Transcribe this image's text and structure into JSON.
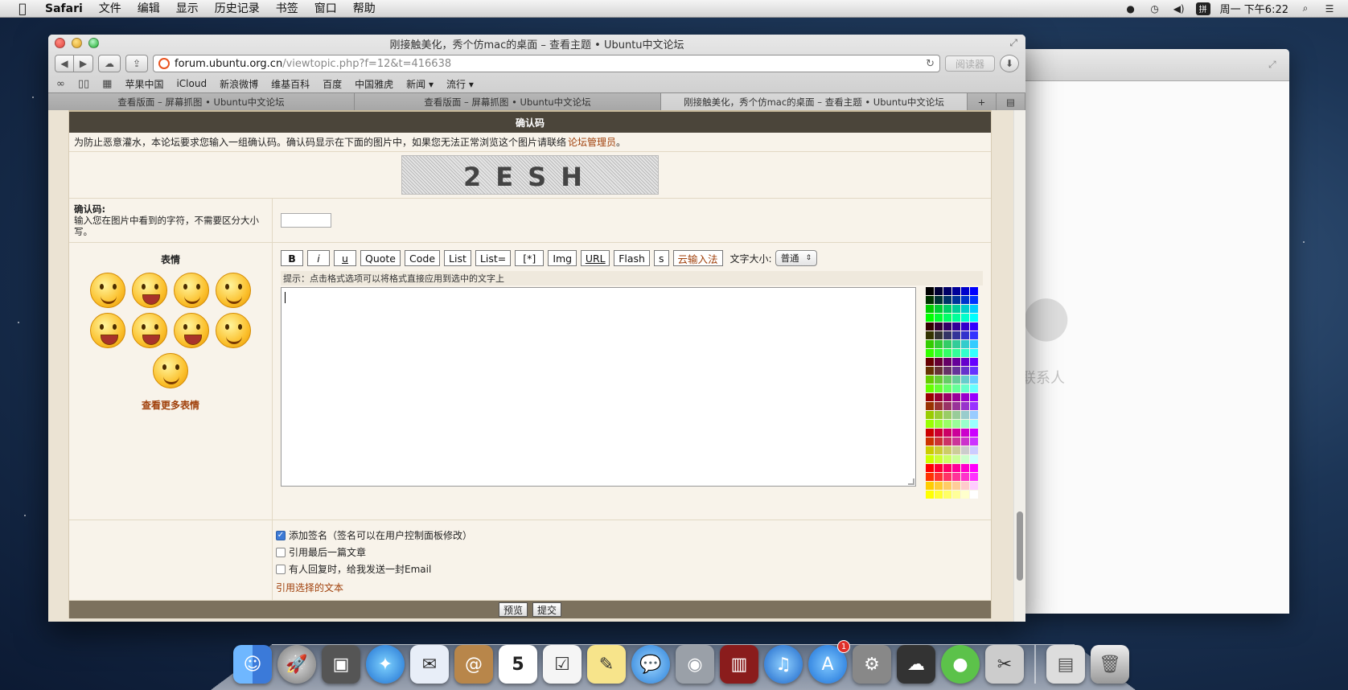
{
  "menubar": {
    "app_name": "Safari",
    "items": [
      "文件",
      "编辑",
      "显示",
      "历史记录",
      "书签",
      "窗口",
      "帮助"
    ],
    "input_method": "拼",
    "clock": "周一 下午6:22"
  },
  "background_window": {
    "contact_label": "联系人"
  },
  "safari": {
    "window_title": "刚接触美化，秀个仿mac的桌面 – 查看主题 • Ubuntu中文论坛",
    "url_host": "forum.ubuntu.org.cn",
    "url_path": "/viewtopic.php?f=12&t=416638",
    "reader_label": "阅读器",
    "bookmarks": [
      "苹果中国",
      "iCloud",
      "新浪微博",
      "维基百科",
      "百度",
      "中国雅虎",
      "新闻 ▾",
      "流行 ▾"
    ],
    "tabs": [
      "查看版面 – 屏幕抓图 • Ubuntu中文论坛",
      "查看版面 – 屏幕抓图 • Ubuntu中文论坛",
      "刚接触美化，秀个仿mac的桌面 – 查看主题 • Ubuntu中文论坛"
    ]
  },
  "form": {
    "header": "确认码",
    "notice": "为防止恶意灌水，本论坛要求您输入一组确认码。确认码显示在下面的图片中，如果您无法正常浏览这个图片请联络",
    "notice_link": "论坛管理员",
    "notice_end": "。",
    "captcha_text": "2ESH",
    "vcode_label": "确认码:",
    "vcode_desc": "输入您在图片中看到的字符，不需要区分大小写。",
    "smiley_title": "表情",
    "more_smileys": "查看更多表情",
    "format_buttons": {
      "bold": "B",
      "italic": "i",
      "underline": "u",
      "quote": "Quote",
      "code": "Code",
      "list": "List",
      "list_eq": "List=",
      "item": "[*]",
      "img": "Img",
      "url": "URL",
      "flash": "Flash",
      "s": "s",
      "cloud_ime": "云输入法"
    },
    "font_size_label": "文字大小:",
    "font_size_value": "普通",
    "hint": "提示：点击格式选项可以将格式直接应用到选中的文字上",
    "options": {
      "signature": "添加签名（签名可以在用户控制面板修改）",
      "quote_last": "引用最后一篇文章",
      "notify": "有人回复时，给我发送一封Email",
      "quote_selected": "引用选择的文本"
    },
    "preview_button": "预览",
    "submit_button": "提交"
  },
  "dock": {
    "calendar_day": "5",
    "appstore_badge": "1"
  },
  "colors": {
    "header_bg": "#4b453a",
    "link": "#a0400b",
    "page_bg": "#f8f3ea"
  }
}
